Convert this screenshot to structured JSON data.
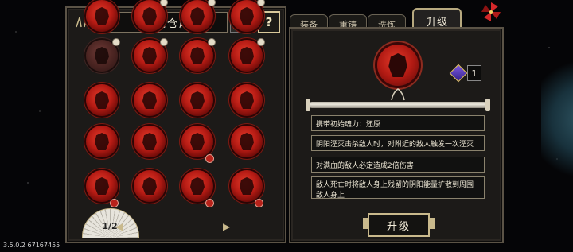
{
  "left_panel": {
    "title": "道魂仓库",
    "help_label": "?",
    "page_indicator": "1/2",
    "prev_label": "◀",
    "next_label": "▶"
  },
  "tabs": [
    {
      "label": "装备",
      "active": false
    },
    {
      "label": "重铸",
      "active": false
    },
    {
      "label": "洗炼",
      "active": false
    },
    {
      "label": "升级",
      "active": true
    }
  ],
  "selected": {
    "gem_count": "1",
    "effects": [
      "携带初始魂力：还原",
      "阴阳湮灭击杀敌人时，对附近的敌人触发一次湮灭",
      "对满血的敌人必定造成2倍伤害",
      "敌人死亡时将敌人身上残留的阴阳能量扩散到周围敌人身上"
    ],
    "upgrade_label": "升级"
  },
  "version_text": "3.5.0.2 67167455",
  "colors": {
    "accent": "#c9b98c",
    "soul_red": "#b51b14",
    "panel": "#1c1a18"
  },
  "grid_items": [
    {
      "badge": "white",
      "dim": true
    },
    {
      "badge": "white",
      "dim": false
    },
    {
      "badge": "white",
      "dim": false
    },
    {
      "badge": "white",
      "dim": false
    },
    {
      "badge": "none",
      "dim": false
    },
    {
      "badge": "none",
      "dim": false
    },
    {
      "badge": "none",
      "dim": false
    },
    {
      "badge": "none",
      "dim": false
    },
    {
      "badge": "none",
      "dim": false
    },
    {
      "badge": "none",
      "dim": false
    },
    {
      "badge": "red",
      "dim": false
    },
    {
      "badge": "none",
      "dim": false
    },
    {
      "badge": "red",
      "dim": false
    },
    {
      "badge": "none",
      "dim": false
    },
    {
      "badge": "red",
      "dim": false
    },
    {
      "badge": "red",
      "dim": false
    },
    {
      "badge": "none",
      "dim": false
    },
    {
      "badge": "white",
      "dim": false
    },
    {
      "badge": "white",
      "dim": false
    },
    {
      "badge": "white",
      "dim": false
    }
  ]
}
